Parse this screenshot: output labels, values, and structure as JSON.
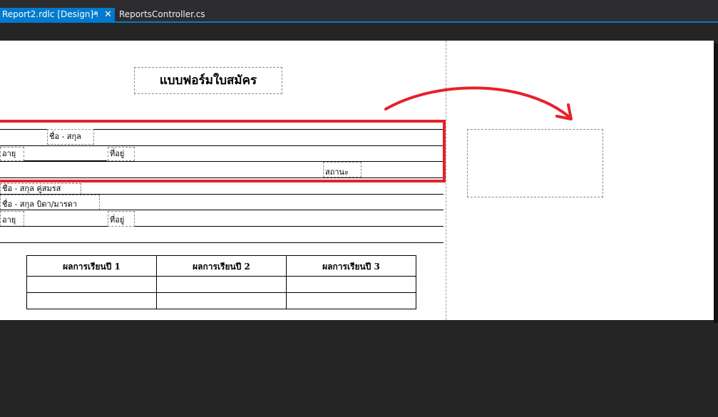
{
  "tabs": {
    "active_label": "Report2.rdlc [Design]*",
    "pin_glyph": "⊣",
    "close_glyph": "✕",
    "inactive_label": "ReportsController.cs"
  },
  "report": {
    "title": "แบบฟอร์มใบสมัคร",
    "fields": {
      "name_label": "ชื่อ - สกุล",
      "age_label_a": "อายุ",
      "address_label_a": "ที่อยู่",
      "status_label": "สถานะ",
      "spouse_label": "ชื่อ - สกุล คู่สมรส",
      "parent_label": "ชื่อ - สกุล บิดา/มารดา",
      "age_label_b": "อายุ",
      "address_label_b": "ที่อยู่"
    },
    "grades_headers": [
      "ผลการเรียนปี 1",
      "ผลการเรียนปี 2",
      "ผลการเรียนปี 3"
    ]
  },
  "colors": {
    "accent": "#007acc",
    "highlight": "#e8202a",
    "background": "#252526"
  }
}
